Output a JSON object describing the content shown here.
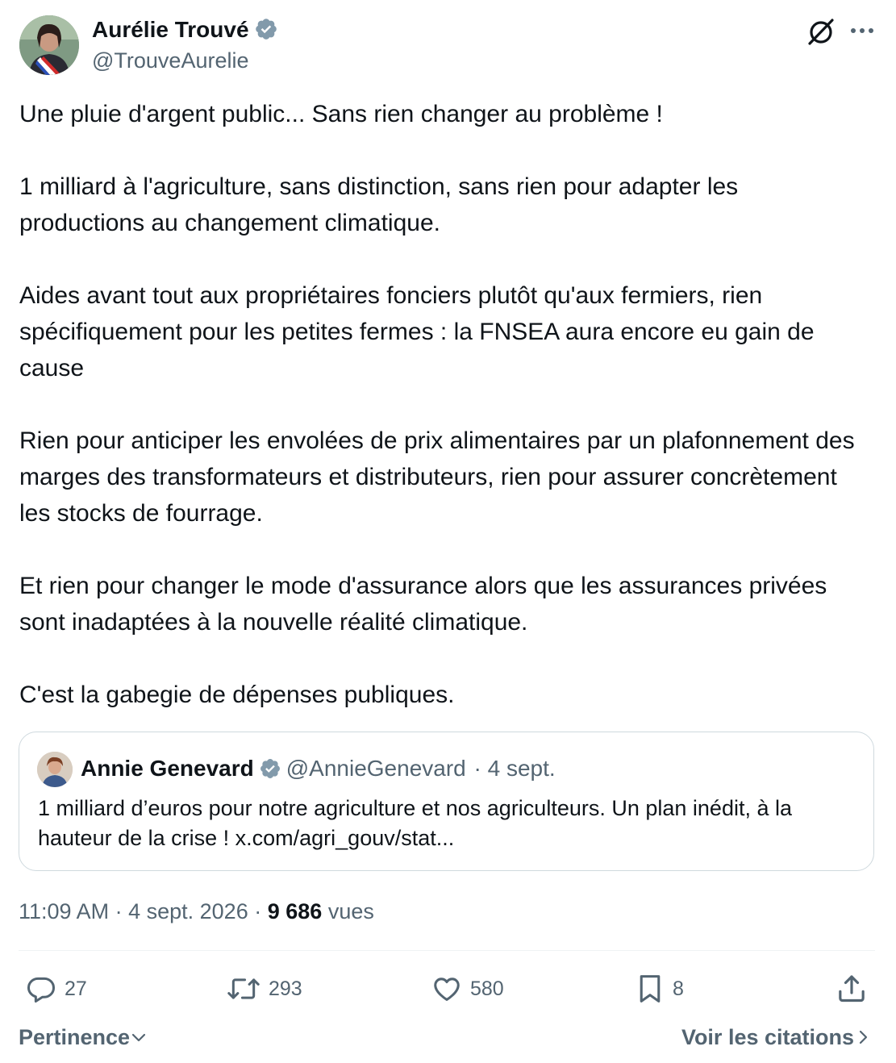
{
  "author": {
    "name": "Aurélie Trouvé",
    "handle": "@TrouveAurelie"
  },
  "tweet": {
    "text": "Une pluie d'argent public... Sans rien changer au problème !\n\n1 milliard à l'agriculture, sans distinction, sans rien pour adapter les productions au changement climatique.\n\nAides avant tout aux propriétaires fonciers plutôt qu'aux fermiers, rien spécifiquement pour les petites fermes : la FNSEA aura encore eu gain de cause\n\nRien pour anticiper les envolées de prix alimentaires par un plafonnement des marges des transformateurs et distributeurs, rien pour assurer concrètement les stocks de fourrage.\n\nEt rien pour changer le mode d'assurance alors que les assurances privées sont inadaptées à la nouvelle réalité climatique.\n\nC'est la gabegie de dépenses publiques."
  },
  "quote": {
    "name": "Annie Genevard",
    "handle": "@AnnieGenevard",
    "date": "· 4 sept.",
    "text": "1 milliard d’euros pour notre agriculture et nos agriculteurs. Un plan inédit, à la hauteur de la crise ! x.com/agri_gouv/stat..."
  },
  "meta": {
    "time": "11:09 AM",
    "date": "· 4 sept. 2026 ·",
    "views_count": "9 686",
    "views_label": "vues"
  },
  "actions": {
    "replies": "27",
    "retweets": "293",
    "likes": "580",
    "bookmarks": "8"
  },
  "footer": {
    "sort_label": "Pertinence",
    "quotes_label": "Voir les citations"
  },
  "colors": {
    "verified": "#829aab",
    "secondary_text": "#536471",
    "primary_text": "#0f1419",
    "border": "#cfd9de"
  },
  "icons": [
    "grok-icon",
    "more-icon",
    "verified-badge-icon",
    "reply-icon",
    "retweet-icon",
    "like-icon",
    "bookmark-icon",
    "share-icon",
    "chevron-down-icon",
    "chevron-right-icon"
  ]
}
